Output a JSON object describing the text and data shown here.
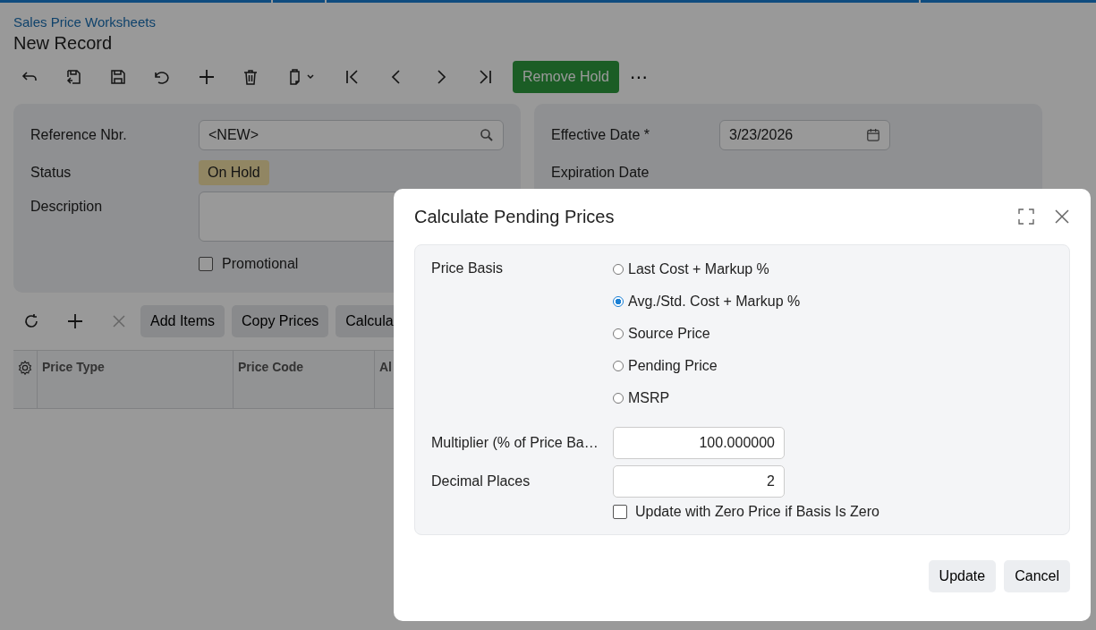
{
  "breadcrumb": "Sales Price Worksheets",
  "title": "New Record",
  "toolbar": {
    "primary_button": "Remove Hold",
    "more": "⋯"
  },
  "form": {
    "reference_nbr": {
      "label": "Reference Nbr.",
      "value": "<NEW>"
    },
    "status": {
      "label": "Status",
      "value": "On Hold"
    },
    "description": {
      "label": "Description"
    },
    "promotional": {
      "label": "Promotional",
      "checked": false
    },
    "effective_date": {
      "label": "Effective Date",
      "required_mark": "*",
      "value": "3/23/2026"
    },
    "expiration_date": {
      "label": "Expiration Date"
    }
  },
  "grid_toolbar": {
    "delete_disabled": true,
    "buttons": [
      "Add Items",
      "Copy Prices",
      "Calcula"
    ]
  },
  "table": {
    "columns": [
      "Price Type",
      "Price Code",
      "Al"
    ]
  },
  "dialog": {
    "title": "Calculate Pending Prices",
    "price_basis": {
      "label": "Price Basis",
      "options": [
        {
          "label": "Last Cost + Markup %",
          "selected": false
        },
        {
          "label": "Avg./Std. Cost + Markup %",
          "selected": true
        },
        {
          "label": "Source Price",
          "selected": false
        },
        {
          "label": "Pending Price",
          "selected": false
        },
        {
          "label": "MSRP",
          "selected": false
        }
      ]
    },
    "multiplier": {
      "label": "Multiplier (% of Price Ba…",
      "value": "100.000000"
    },
    "decimal_places": {
      "label": "Decimal Places",
      "value": "2"
    },
    "zero_price": {
      "label": "Update with Zero Price if Basis Is Zero",
      "checked": false
    },
    "buttons": [
      "Update",
      "Cancel"
    ]
  }
}
